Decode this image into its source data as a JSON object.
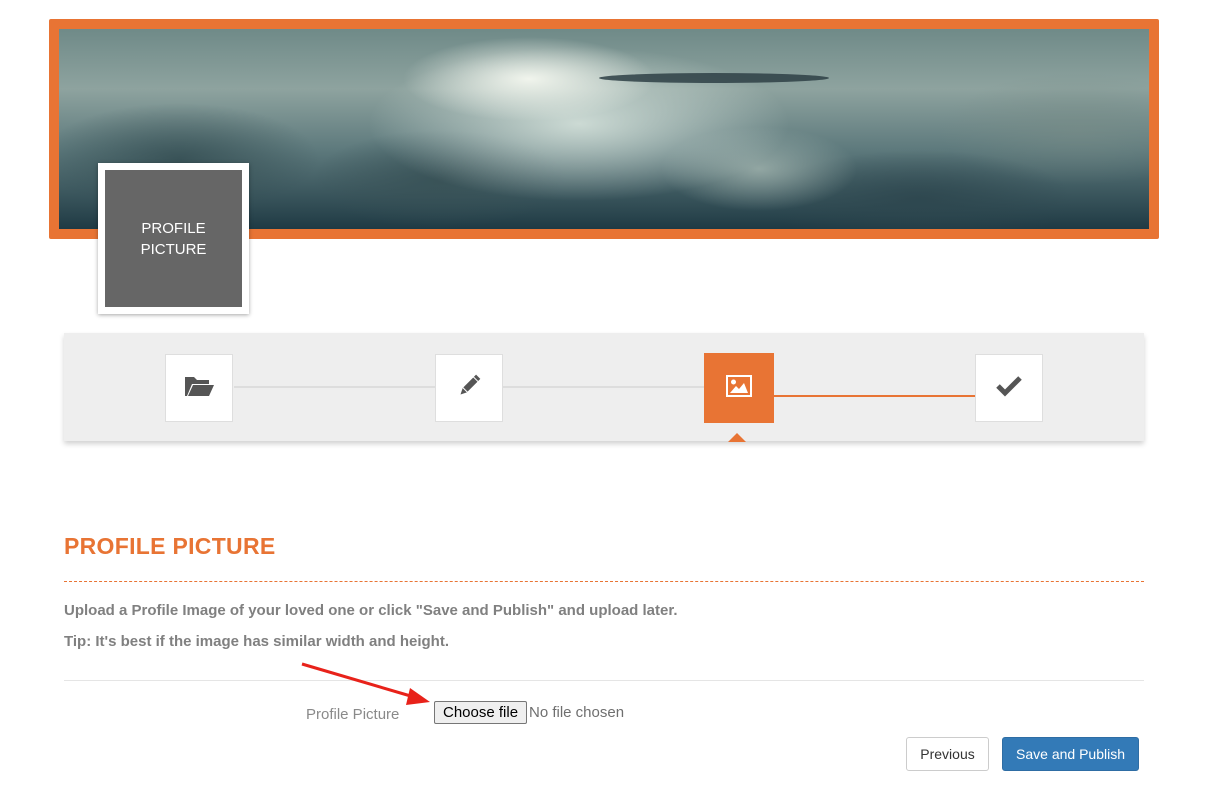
{
  "banner": {
    "image": "cloudy-sky-cover-photo",
    "frame_color": "#e87434"
  },
  "profile_placeholder": {
    "line1": "PROFILE",
    "line2": "PICTURE"
  },
  "wizard": {
    "steps": [
      {
        "icon": "folder-open-icon",
        "state": "complete"
      },
      {
        "icon": "pencil-icon",
        "state": "complete"
      },
      {
        "icon": "image-icon",
        "state": "active"
      },
      {
        "icon": "checkmark-icon",
        "state": "pending"
      }
    ]
  },
  "section": {
    "title": "PROFILE PICTURE",
    "description": "Upload a Profile Image of your loved one or click \"Save and Publish\" and upload later.",
    "tip": "Tip: It's best if the image has similar width and height."
  },
  "form": {
    "label": "Profile Picture",
    "file_button": "Choose file",
    "file_status": "No file chosen"
  },
  "buttons": {
    "previous": "Previous",
    "save": "Save and Publish"
  },
  "colors": {
    "accent": "#e87434",
    "primary": "#337ab7",
    "annotation_arrow": "#e8221a"
  }
}
